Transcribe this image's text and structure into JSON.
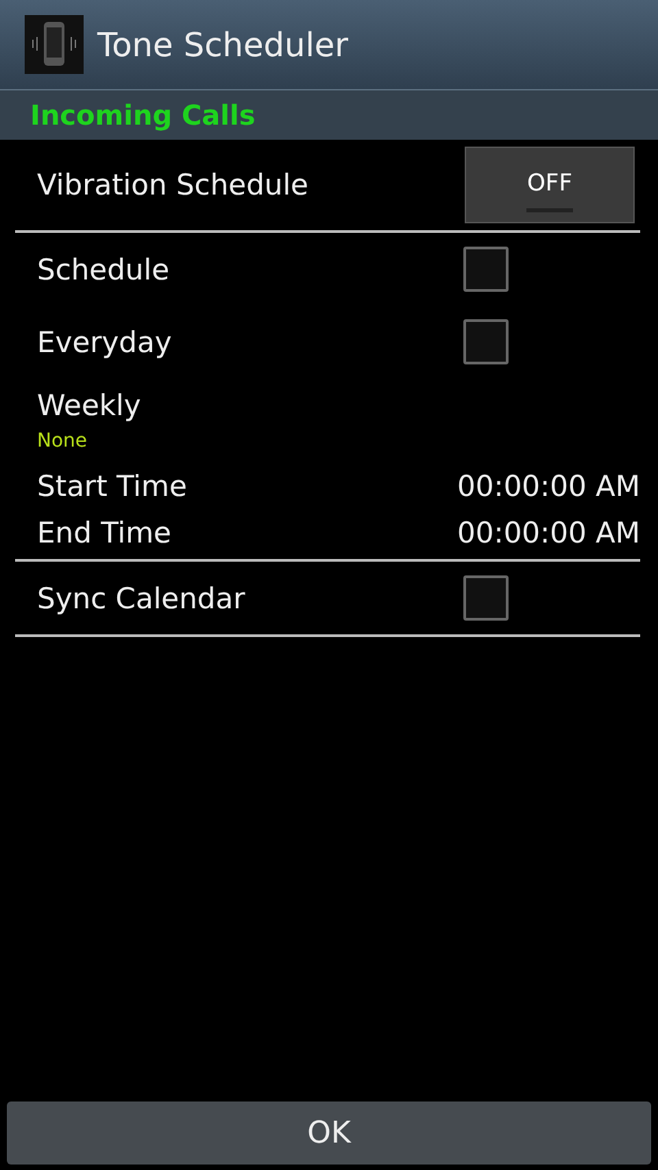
{
  "app_bar": {
    "title": "Tone Scheduler"
  },
  "section_header": "Incoming Calls",
  "groups": [
    {
      "items": [
        {
          "kind": "toggle",
          "label": "Vibration Schedule",
          "on": false,
          "state_text": "OFF"
        }
      ]
    },
    {
      "items": [
        {
          "kind": "checkbox",
          "label": "Schedule",
          "checked": false
        },
        {
          "kind": "checkbox",
          "label": "Everyday",
          "checked": false
        },
        {
          "kind": "option",
          "label": "Weekly",
          "summary": "None"
        },
        {
          "kind": "time",
          "label": "Start Time",
          "value": "00:00:00 AM"
        },
        {
          "kind": "time",
          "label": "End Time",
          "value": "00:00:00 AM"
        }
      ]
    },
    {
      "items": [
        {
          "kind": "checkbox",
          "label": "Sync Calendar",
          "checked": false
        }
      ]
    }
  ],
  "ok_button": "OK"
}
